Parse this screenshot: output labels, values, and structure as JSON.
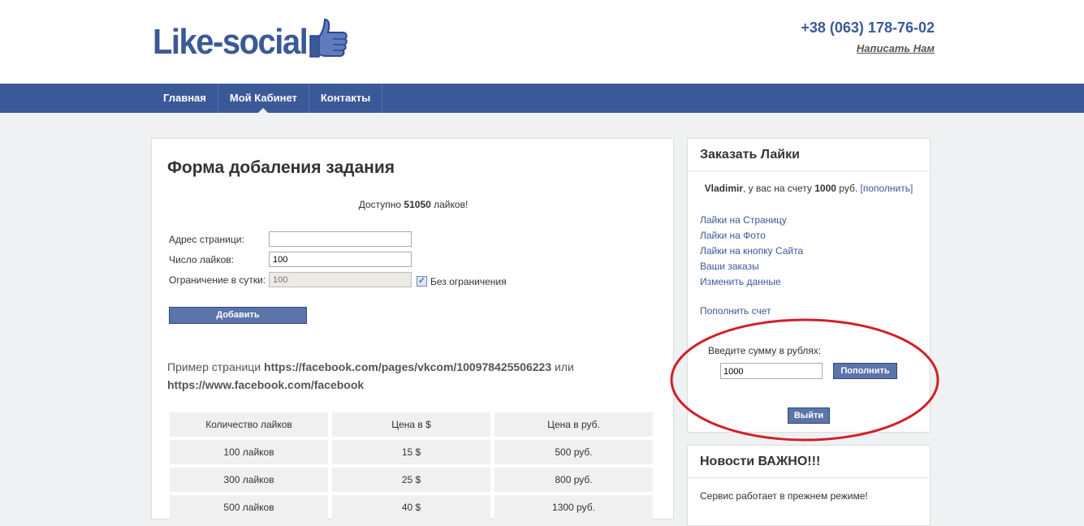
{
  "header": {
    "logo_text": "Like-social",
    "phone": "+38 (063) 178-76-02",
    "write_us": "Написать Нам"
  },
  "nav": {
    "items": [
      {
        "label": "Главная"
      },
      {
        "label": "Мой Кабинет",
        "active": true
      },
      {
        "label": "Контакты"
      }
    ]
  },
  "form": {
    "title": "Форма добаления задания",
    "available_prefix": "Доступно ",
    "available_count": "51050",
    "available_suffix": " лайков!",
    "page_address_label": "Адрес страници:",
    "page_address_value": "",
    "likes_count_label": "Число лайков:",
    "likes_count_value": "100",
    "daily_limit_label": "Ограничение в сутки:",
    "daily_limit_value": "100",
    "no_limit_label": "Без ограничения",
    "no_limit_checked": true,
    "add_button": "Добавить",
    "example_prefix": "Пример страници ",
    "example_url1": "https://facebook.com/pages/vkcom/100978425506223",
    "example_or": " или",
    "example_url2": "https://www.facebook.com/facebook"
  },
  "price_table": {
    "headers": [
      "Количество лайков",
      "Цена в $",
      "Цена в руб."
    ],
    "rows": [
      [
        "100 лайков",
        "15 $",
        "500 руб."
      ],
      [
        "300 лайков",
        "25 $",
        "800 руб."
      ],
      [
        "500 лайков",
        "40 $",
        "1300 руб."
      ]
    ]
  },
  "sidebar": {
    "title": "Заказать Лайки",
    "user": "Vladimir",
    "balance_text_1": ", у вас на счету ",
    "balance": "1000",
    "balance_text_2": " руб. ",
    "refill_bracket_link": "[пополнить]",
    "links": [
      "Лайки на Страницу",
      "Лайки на Фото",
      "Лайки на кнопку Сайта",
      "Ваши заказы",
      "Изменить данные"
    ],
    "refill_account_link": "Пополнить счет",
    "sum_label": "Введите сумму в рублях:",
    "sum_value": "1000",
    "refill_button": "Пополнить",
    "exit_button": "Выйти"
  },
  "news": {
    "title": "Новости ВАЖНО!!!",
    "text": "Сервис работает в прежнем режиме!"
  },
  "colors": {
    "brand": "#3b5998",
    "button": "#5b75aa",
    "annotation": "#d0202a"
  }
}
